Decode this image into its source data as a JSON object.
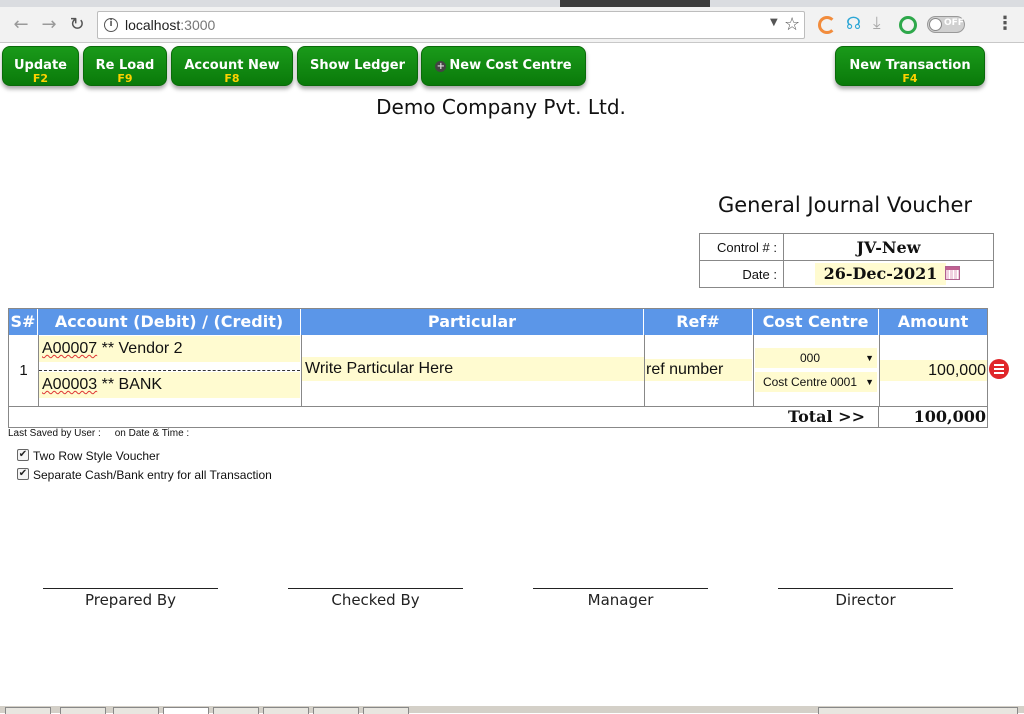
{
  "browser": {
    "url_host": "localhost",
    "url_port": ":3000",
    "toggle_label": "OFF"
  },
  "toolbar": {
    "update": {
      "label": "Update",
      "key": "F2"
    },
    "reload": {
      "label": "Re Load",
      "key": "F9"
    },
    "account_new": {
      "label": "Account New",
      "key": "F8"
    },
    "show_ledger": {
      "label": "Show Ledger"
    },
    "new_cost_centre": {
      "label": "New Cost Centre"
    },
    "new_transaction": {
      "label": "New Transaction",
      "key": "F4"
    }
  },
  "header": {
    "company": "Demo Company Pvt. Ltd.",
    "voucher_title": "General Journal Voucher",
    "control_label": "Control # :",
    "control_value": "JV-New",
    "date_label": "Date :",
    "date_value": "26-Dec-2021"
  },
  "table": {
    "columns": [
      "S#",
      "Account (Debit) / (Credit)",
      "Particular",
      "Ref#",
      "Cost Centre",
      "Amount"
    ],
    "rows": [
      {
        "sn": "1",
        "debit_code": "A00007",
        "debit_name": " ** Vendor 2",
        "credit_code": "A00003",
        "credit_name": " ** BANK",
        "particular": "Write Particular Here",
        "ref": "ref number",
        "cost_centre_debit": "000",
        "cost_centre_credit": "Cost Centre 0001",
        "amount": "100,000"
      }
    ],
    "total_label": "Total >>",
    "total_value": "100,000"
  },
  "footer": {
    "last_saved": "Last Saved by User :     on Date & Time :",
    "options": [
      {
        "label": "Two Row Style Voucher",
        "checked": true
      },
      {
        "label": "Separate Cash/Bank entry for all Transaction",
        "checked": true
      }
    ],
    "signatures": [
      "Prepared By",
      "Checked By",
      "Manager",
      "Director"
    ]
  },
  "colors": {
    "button_green": "#0f8a0f",
    "shortcut_yellow": "#ffd200",
    "header_blue": "#5b96e8",
    "input_yellow": "#fffbd0",
    "delete_red": "#e0262a"
  }
}
